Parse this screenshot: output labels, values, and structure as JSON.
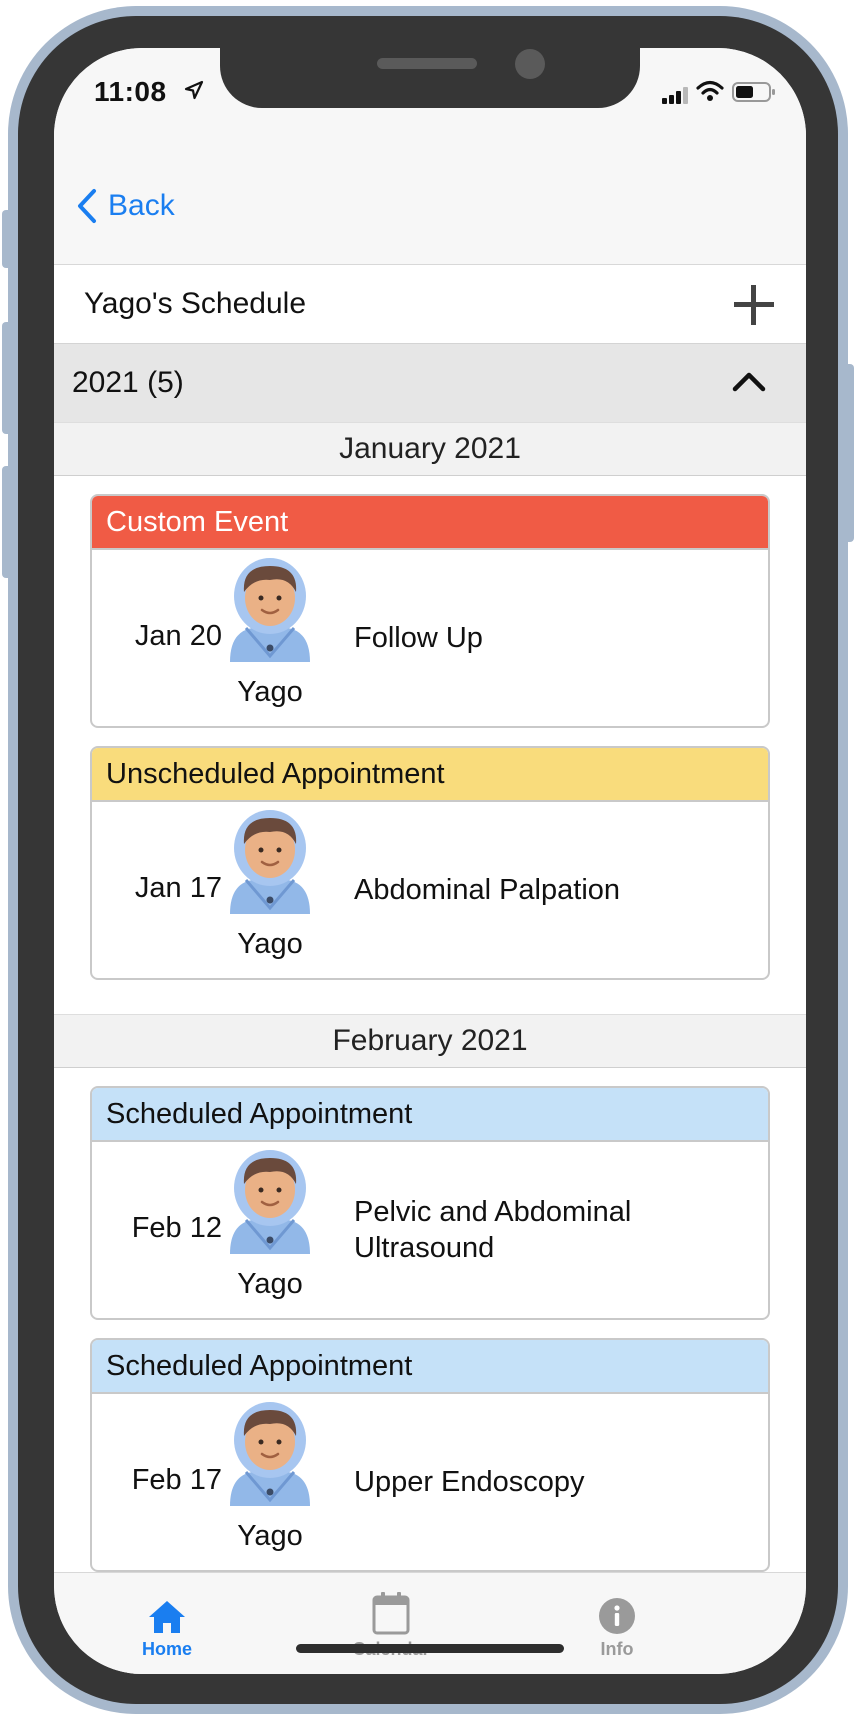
{
  "status": {
    "time": "11:08"
  },
  "nav": {
    "back_label": "Back"
  },
  "header": {
    "title": "Yago's Schedule"
  },
  "group": {
    "label": "2021 (5)"
  },
  "colors": {
    "custom": "#f05b45",
    "unscheduled": "#f9dc7c",
    "scheduled": "#c5e1f8",
    "accent": "#1a7ef0"
  },
  "months": [
    {
      "label": "January 2021",
      "events": [
        {
          "type": "Custom Event",
          "date": "Jan 20",
          "person": "Yago",
          "title": "Follow Up"
        },
        {
          "type": "Unscheduled Appointment",
          "date": "Jan 17",
          "person": "Yago",
          "title": "Abdominal Palpation"
        }
      ]
    },
    {
      "label": "February 2021",
      "events": [
        {
          "type": "Scheduled Appointment",
          "date": "Feb 12",
          "person": "Yago",
          "title": "Pelvic and Abdominal Ultrasound"
        },
        {
          "type": "Scheduled Appointment",
          "date": "Feb 17",
          "person": "Yago",
          "title": "Upper Endoscopy"
        }
      ]
    }
  ],
  "tabs": [
    {
      "label": "Home",
      "icon": "home-icon",
      "active": true
    },
    {
      "label": "Calendar",
      "icon": "calendar-icon",
      "active": false
    },
    {
      "label": "Info",
      "icon": "info-icon",
      "active": false
    }
  ]
}
